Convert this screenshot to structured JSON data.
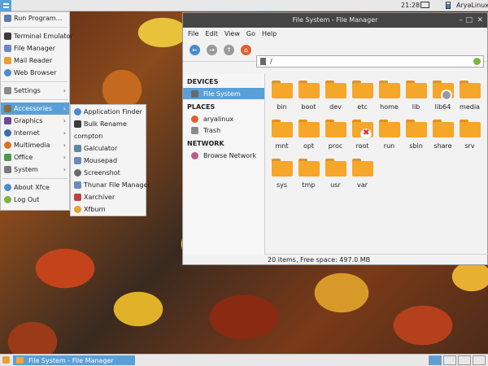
{
  "topbar": {
    "clock": "21:28",
    "user": "AryaLinux"
  },
  "mainmenu": {
    "items": [
      {
        "label": "Run Program...",
        "icon": "run-icon",
        "color": "#5a7ab0"
      },
      {
        "label": "Terminal Emulator",
        "icon": "terminal-icon",
        "color": "#3a3a3a"
      },
      {
        "label": "File Manager",
        "icon": "file-manager-icon",
        "color": "#6a8ac0"
      },
      {
        "label": "Mail Reader",
        "icon": "mail-icon",
        "color": "#e8a030"
      },
      {
        "label": "Web Browser",
        "icon": "web-browser-icon",
        "color": "#4a8ad0"
      },
      {
        "label": "Settings",
        "icon": "settings-icon",
        "color": "#8a8a8a"
      },
      {
        "label": "Accessories",
        "icon": "accessories-icon",
        "color": "#8a6a4a"
      },
      {
        "label": "Graphics",
        "icon": "graphics-icon",
        "color": "#6a4a9a"
      },
      {
        "label": "Internet",
        "icon": "internet-icon",
        "color": "#3a6ab0"
      },
      {
        "label": "Multimedia",
        "icon": "multimedia-icon",
        "color": "#e07020"
      },
      {
        "label": "Office",
        "icon": "office-icon",
        "color": "#4a9a4a"
      },
      {
        "label": "System",
        "icon": "system-icon",
        "color": "#7a7a7a"
      },
      {
        "label": "About Xfce",
        "icon": "about-icon",
        "color": "#4a8ad0"
      },
      {
        "label": "Log Out",
        "icon": "logout-icon",
        "color": "#7ab640"
      }
    ]
  },
  "submenu": {
    "items": [
      {
        "label": "Application Finder",
        "icon": "app-finder-icon",
        "color": "#4a8ad0"
      },
      {
        "label": "Bulk Rename",
        "icon": "bulk-rename-icon",
        "color": "#3a3a3a"
      },
      {
        "label": "compton",
        "icon": "",
        "color": ""
      },
      {
        "label": "Galculator",
        "icon": "calculator-icon",
        "color": "#5a8aa0"
      },
      {
        "label": "Mousepad",
        "icon": "mousepad-icon",
        "color": "#6a8ac0"
      },
      {
        "label": "Screenshot",
        "icon": "screenshot-icon",
        "color": "#6a6a6a"
      },
      {
        "label": "Thunar File Manager",
        "icon": "thunar-icon",
        "color": "#6a8ac0"
      },
      {
        "label": "Xarchiver",
        "icon": "archiver-icon",
        "color": "#c04040"
      },
      {
        "label": "Xfburn",
        "icon": "xfburn-icon",
        "color": "#e8a030"
      }
    ]
  },
  "filemanager": {
    "title": "File System - File Manager",
    "menu": [
      "File",
      "Edit",
      "View",
      "Go",
      "Help"
    ],
    "location": "/",
    "sidebar": {
      "devices_header": "DEVICES",
      "devices": [
        "File System"
      ],
      "places_header": "PLACES",
      "places": [
        "aryalinux",
        "Trash"
      ],
      "network_header": "NETWORK",
      "network": [
        "Browse Network"
      ]
    },
    "files": [
      "bin",
      "boot",
      "dev",
      "etc",
      "home",
      "lib",
      "lib64",
      "media",
      "mnt",
      "opt",
      "proc",
      "root",
      "run",
      "sbin",
      "share",
      "srv",
      "sys",
      "tmp",
      "usr",
      "var"
    ],
    "status": "20 items, Free space: 497.0 MB"
  },
  "taskbar": {
    "task_label": "File System - File Manager"
  },
  "colors": {
    "accent": "#5aa0d8",
    "folder": "#f6a628"
  }
}
